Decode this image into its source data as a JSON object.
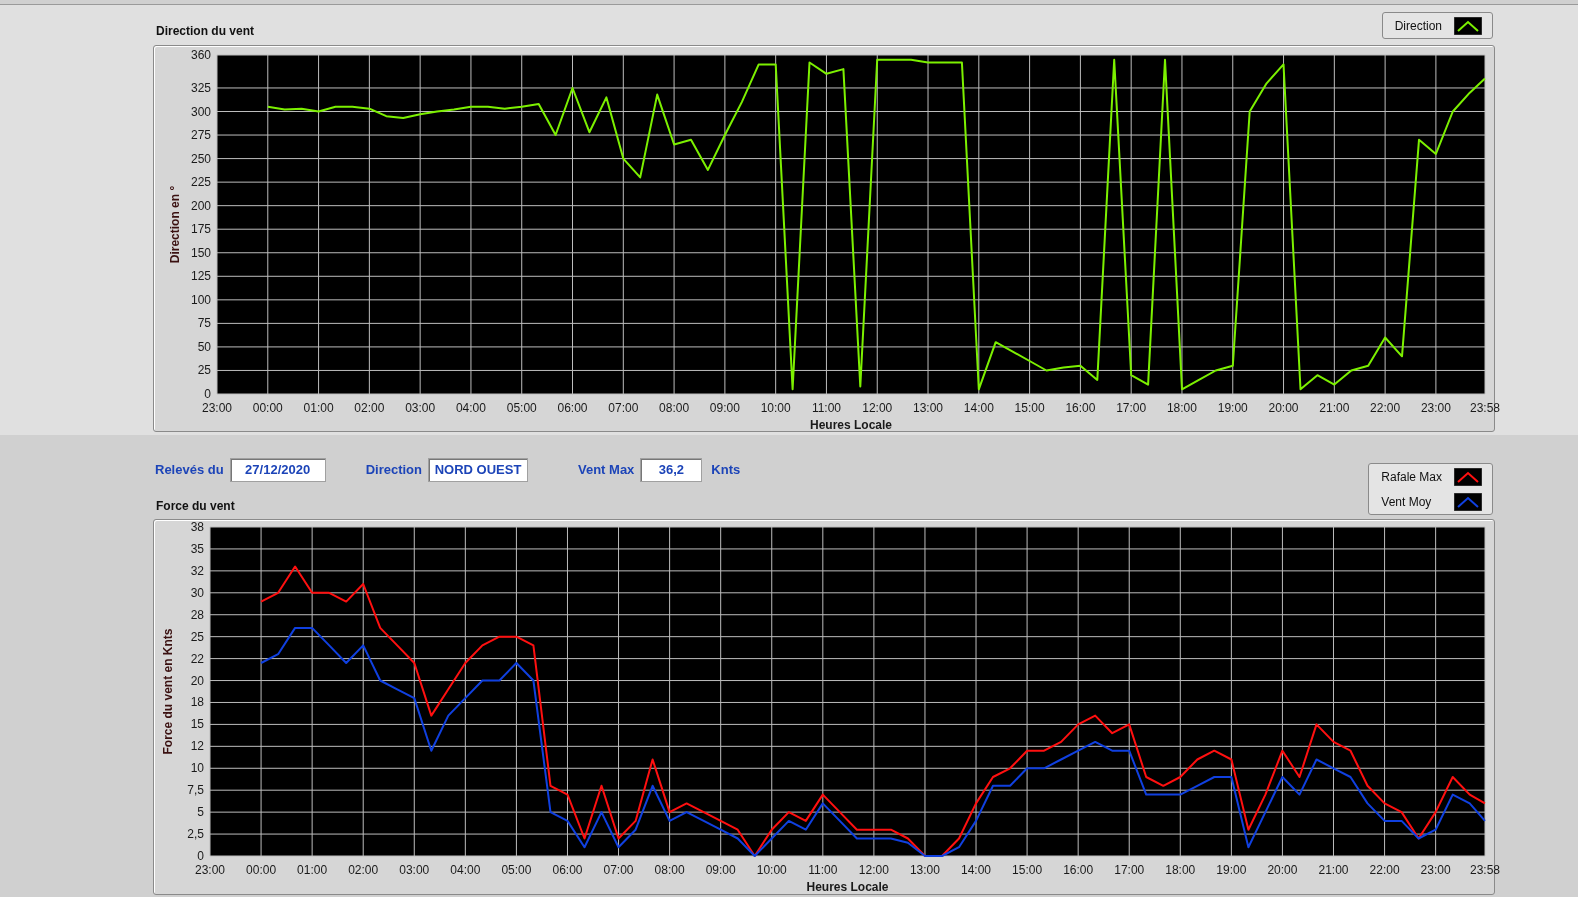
{
  "direction_panel": {
    "chart_data": {
      "type": "line",
      "title": "Direction du vent",
      "xlabel": "Heures Locale",
      "ylabel": "Direction en °",
      "x": [
        "2020-12-27T00:00",
        "2020-12-27T00:20",
        "2020-12-27T00:40",
        "2020-12-27T01:00",
        "2020-12-27T01:20",
        "2020-12-27T01:40",
        "2020-12-27T02:00",
        "2020-12-27T02:20",
        "2020-12-27T02:40",
        "2020-12-27T03:00",
        "2020-12-27T03:20",
        "2020-12-27T03:40",
        "2020-12-27T04:00",
        "2020-12-27T04:20",
        "2020-12-27T04:40",
        "2020-12-27T05:00",
        "2020-12-27T05:20",
        "2020-12-27T05:40",
        "2020-12-27T06:00",
        "2020-12-27T06:20",
        "2020-12-27T06:40",
        "2020-12-27T07:00",
        "2020-12-27T07:20",
        "2020-12-27T07:40",
        "2020-12-27T08:00",
        "2020-12-27T08:20",
        "2020-12-27T08:40",
        "2020-12-27T09:00",
        "2020-12-27T09:20",
        "2020-12-27T09:40",
        "2020-12-27T10:00",
        "2020-12-27T10:20",
        "2020-12-27T10:40",
        "2020-12-27T11:00",
        "2020-12-27T11:20",
        "2020-12-27T11:40",
        "2020-12-27T12:00",
        "2020-12-27T12:20",
        "2020-12-27T12:40",
        "2020-12-27T13:00",
        "2020-12-27T13:20",
        "2020-12-27T13:40",
        "2020-12-27T14:00",
        "2020-12-27T14:20",
        "2020-12-27T14:40",
        "2020-12-27T15:00",
        "2020-12-27T15:20",
        "2020-12-27T15:40",
        "2020-12-27T16:00",
        "2020-12-27T16:20",
        "2020-12-27T16:40",
        "2020-12-27T17:00",
        "2020-12-27T17:20",
        "2020-12-27T17:40",
        "2020-12-27T18:00",
        "2020-12-27T18:20",
        "2020-12-27T18:40",
        "2020-12-27T19:00",
        "2020-12-27T19:20",
        "2020-12-27T19:40",
        "2020-12-27T20:00",
        "2020-12-27T20:20",
        "2020-12-27T20:40",
        "2020-12-27T21:00",
        "2020-12-27T21:20",
        "2020-12-27T21:40",
        "2020-12-27T22:00",
        "2020-12-27T22:20",
        "2020-12-27T22:40",
        "2020-12-27T23:00",
        "2020-12-27T23:20",
        "2020-12-27T23:40",
        "2020-12-27T23:58"
      ],
      "series": [
        {
          "name": "Direction",
          "color": "#7cf000",
          "values": [
            305,
            302,
            303,
            300,
            305,
            305,
            303,
            295,
            293,
            297,
            300,
            302,
            305,
            305,
            303,
            305,
            308,
            275,
            325,
            278,
            315,
            250,
            230,
            318,
            265,
            270,
            238,
            275,
            310,
            350,
            350,
            5,
            352,
            340,
            345,
            8,
            355,
            355,
            355,
            352,
            352,
            352,
            5,
            55,
            45,
            35,
            25,
            28,
            30,
            15,
            355,
            20,
            10,
            355,
            5,
            15,
            25,
            30,
            300,
            330,
            350,
            5,
            20,
            10,
            25,
            30,
            60,
            40,
            270,
            255,
            300,
            320,
            335
          ]
        }
      ],
      "xlim": [
        "2020-12-26T23:00",
        "2020-12-27T23:58"
      ],
      "ylim": [
        0,
        360
      ],
      "xticks": [
        {
          "value": "2020-12-26T23:00",
          "label": "23:00"
        },
        {
          "value": "2020-12-27T00:00",
          "label": "00:00"
        },
        {
          "value": "2020-12-27T01:00",
          "label": "01:00"
        },
        {
          "value": "2020-12-27T02:00",
          "label": "02:00"
        },
        {
          "value": "2020-12-27T03:00",
          "label": "03:00"
        },
        {
          "value": "2020-12-27T04:00",
          "label": "04:00"
        },
        {
          "value": "2020-12-27T05:00",
          "label": "05:00"
        },
        {
          "value": "2020-12-27T06:00",
          "label": "06:00"
        },
        {
          "value": "2020-12-27T07:00",
          "label": "07:00"
        },
        {
          "value": "2020-12-27T08:00",
          "label": "08:00"
        },
        {
          "value": "2020-12-27T09:00",
          "label": "09:00"
        },
        {
          "value": "2020-12-27T10:00",
          "label": "10:00"
        },
        {
          "value": "2020-12-27T11:00",
          "label": "11:00"
        },
        {
          "value": "2020-12-27T12:00",
          "label": "12:00"
        },
        {
          "value": "2020-12-27T13:00",
          "label": "13:00"
        },
        {
          "value": "2020-12-27T14:00",
          "label": "14:00"
        },
        {
          "value": "2020-12-27T15:00",
          "label": "15:00"
        },
        {
          "value": "2020-12-27T16:00",
          "label": "16:00"
        },
        {
          "value": "2020-12-27T17:00",
          "label": "17:00"
        },
        {
          "value": "2020-12-27T18:00",
          "label": "18:00"
        },
        {
          "value": "2020-12-27T19:00",
          "label": "19:00"
        },
        {
          "value": "2020-12-27T20:00",
          "label": "20:00"
        },
        {
          "value": "2020-12-27T21:00",
          "label": "21:00"
        },
        {
          "value": "2020-12-27T22:00",
          "label": "22:00"
        },
        {
          "value": "2020-12-27T23:00",
          "label": "23:00"
        },
        {
          "value": "2020-12-27T23:58",
          "label": "23:58"
        }
      ],
      "yticks": [
        0,
        25,
        50,
        75,
        100,
        125,
        150,
        175,
        200,
        225,
        250,
        275,
        300,
        325,
        360
      ],
      "grid": true
    }
  },
  "readings": [
    {
      "label": "Relevés du",
      "value": "27/12/2020"
    },
    {
      "label": "Direction",
      "value": "NORD OUEST"
    },
    {
      "label": "Vent Max",
      "value": "36,2",
      "unit": "Knts"
    }
  ],
  "force_panel": {
    "chart_data": {
      "type": "line",
      "title": "Force du vent",
      "xlabel": "Heures Locale",
      "ylabel": "Force du vent en Knts",
      "x": [
        "2020-12-27T00:00",
        "2020-12-27T00:20",
        "2020-12-27T00:40",
        "2020-12-27T01:00",
        "2020-12-27T01:20",
        "2020-12-27T01:40",
        "2020-12-27T02:00",
        "2020-12-27T02:20",
        "2020-12-27T02:40",
        "2020-12-27T03:00",
        "2020-12-27T03:20",
        "2020-12-27T03:40",
        "2020-12-27T04:00",
        "2020-12-27T04:20",
        "2020-12-27T04:40",
        "2020-12-27T05:00",
        "2020-12-27T05:20",
        "2020-12-27T05:40",
        "2020-12-27T06:00",
        "2020-12-27T06:20",
        "2020-12-27T06:40",
        "2020-12-27T07:00",
        "2020-12-27T07:20",
        "2020-12-27T07:40",
        "2020-12-27T08:00",
        "2020-12-27T08:20",
        "2020-12-27T08:40",
        "2020-12-27T09:00",
        "2020-12-27T09:20",
        "2020-12-27T09:40",
        "2020-12-27T10:00",
        "2020-12-27T10:20",
        "2020-12-27T10:40",
        "2020-12-27T11:00",
        "2020-12-27T11:20",
        "2020-12-27T11:40",
        "2020-12-27T12:00",
        "2020-12-27T12:20",
        "2020-12-27T12:40",
        "2020-12-27T13:00",
        "2020-12-27T13:20",
        "2020-12-27T13:40",
        "2020-12-27T14:00",
        "2020-12-27T14:20",
        "2020-12-27T14:40",
        "2020-12-27T15:00",
        "2020-12-27T15:20",
        "2020-12-27T15:40",
        "2020-12-27T16:00",
        "2020-12-27T16:20",
        "2020-12-27T16:40",
        "2020-12-27T17:00",
        "2020-12-27T17:20",
        "2020-12-27T17:40",
        "2020-12-27T18:00",
        "2020-12-27T18:20",
        "2020-12-27T18:40",
        "2020-12-27T19:00",
        "2020-12-27T19:20",
        "2020-12-27T19:40",
        "2020-12-27T20:00",
        "2020-12-27T20:20",
        "2020-12-27T20:40",
        "2020-12-27T21:00",
        "2020-12-27T21:20",
        "2020-12-27T21:40",
        "2020-12-27T22:00",
        "2020-12-27T22:20",
        "2020-12-27T22:40",
        "2020-12-27T23:00",
        "2020-12-27T23:20",
        "2020-12-27T23:40",
        "2020-12-27T23:58"
      ],
      "series": [
        {
          "name": "Rafale Max",
          "color": "#ff1010",
          "values": [
            29,
            30,
            33,
            30,
            30,
            29,
            31,
            26,
            24,
            22,
            16,
            19,
            22,
            24,
            25,
            25,
            24,
            8,
            7,
            2,
            8,
            2,
            4,
            11,
            5,
            6,
            5,
            4,
            3,
            0,
            3,
            5,
            4,
            7,
            5,
            3,
            3,
            3,
            2,
            0,
            0,
            2,
            6,
            9,
            10,
            12,
            12,
            13,
            15,
            16,
            14,
            15,
            9,
            8,
            9,
            11,
            12,
            11,
            3,
            7,
            12,
            9,
            15,
            13,
            12,
            8,
            6,
            5,
            2,
            5,
            9,
            7,
            6
          ]
        },
        {
          "name": "Vent Moy",
          "color": "#1040e0",
          "values": [
            22,
            23,
            26,
            26,
            24,
            22,
            24,
            20,
            19,
            18,
            12,
            16,
            18,
            20,
            20,
            22,
            20,
            5,
            4,
            1,
            5,
            1,
            3,
            8,
            4,
            5,
            4,
            3,
            2,
            0,
            2,
            4,
            3,
            6,
            4,
            2,
            2,
            2,
            1.5,
            0,
            0,
            1,
            4,
            8,
            8,
            10,
            10,
            11,
            12,
            13,
            12,
            12,
            7,
            7,
            7,
            8,
            9,
            9,
            1,
            5,
            9,
            7,
            11,
            10,
            9,
            6,
            4,
            4,
            2,
            3,
            7,
            6,
            4
          ]
        }
      ],
      "xlim": [
        "2020-12-26T23:00",
        "2020-12-27T23:58"
      ],
      "ylim": [
        0,
        37.5
      ],
      "xticks": [
        {
          "value": "2020-12-26T23:00",
          "label": "23:00"
        },
        {
          "value": "2020-12-27T00:00",
          "label": "00:00"
        },
        {
          "value": "2020-12-27T01:00",
          "label": "01:00"
        },
        {
          "value": "2020-12-27T02:00",
          "label": "02:00"
        },
        {
          "value": "2020-12-27T03:00",
          "label": "03:00"
        },
        {
          "value": "2020-12-27T04:00",
          "label": "04:00"
        },
        {
          "value": "2020-12-27T05:00",
          "label": "05:00"
        },
        {
          "value": "2020-12-27T06:00",
          "label": "06:00"
        },
        {
          "value": "2020-12-27T07:00",
          "label": "07:00"
        },
        {
          "value": "2020-12-27T08:00",
          "label": "08:00"
        },
        {
          "value": "2020-12-27T09:00",
          "label": "09:00"
        },
        {
          "value": "2020-12-27T10:00",
          "label": "10:00"
        },
        {
          "value": "2020-12-27T11:00",
          "label": "11:00"
        },
        {
          "value": "2020-12-27T12:00",
          "label": "12:00"
        },
        {
          "value": "2020-12-27T13:00",
          "label": "13:00"
        },
        {
          "value": "2020-12-27T14:00",
          "label": "14:00"
        },
        {
          "value": "2020-12-27T15:00",
          "label": "15:00"
        },
        {
          "value": "2020-12-27T16:00",
          "label": "16:00"
        },
        {
          "value": "2020-12-27T17:00",
          "label": "17:00"
        },
        {
          "value": "2020-12-27T18:00",
          "label": "18:00"
        },
        {
          "value": "2020-12-27T19:00",
          "label": "19:00"
        },
        {
          "value": "2020-12-27T20:00",
          "label": "20:00"
        },
        {
          "value": "2020-12-27T21:00",
          "label": "21:00"
        },
        {
          "value": "2020-12-27T22:00",
          "label": "22:00"
        },
        {
          "value": "2020-12-27T23:00",
          "label": "23:00"
        },
        {
          "value": "2020-12-27T23:58",
          "label": "23:58"
        }
      ],
      "yticks": [
        0,
        {
          "value": 2.5,
          "label": "2,5"
        },
        5,
        {
          "value": 7.5,
          "label": "7,5"
        },
        10,
        {
          "value": 12.5,
          "label": "12"
        },
        15,
        {
          "value": 17.5,
          "label": "18"
        },
        20,
        {
          "value": 22.5,
          "label": "22"
        },
        25,
        {
          "value": 27.5,
          "label": "28"
        },
        30,
        {
          "value": 32.5,
          "label": "32"
        },
        35,
        {
          "value": 37.5,
          "label": "38"
        }
      ],
      "grid": true
    }
  }
}
